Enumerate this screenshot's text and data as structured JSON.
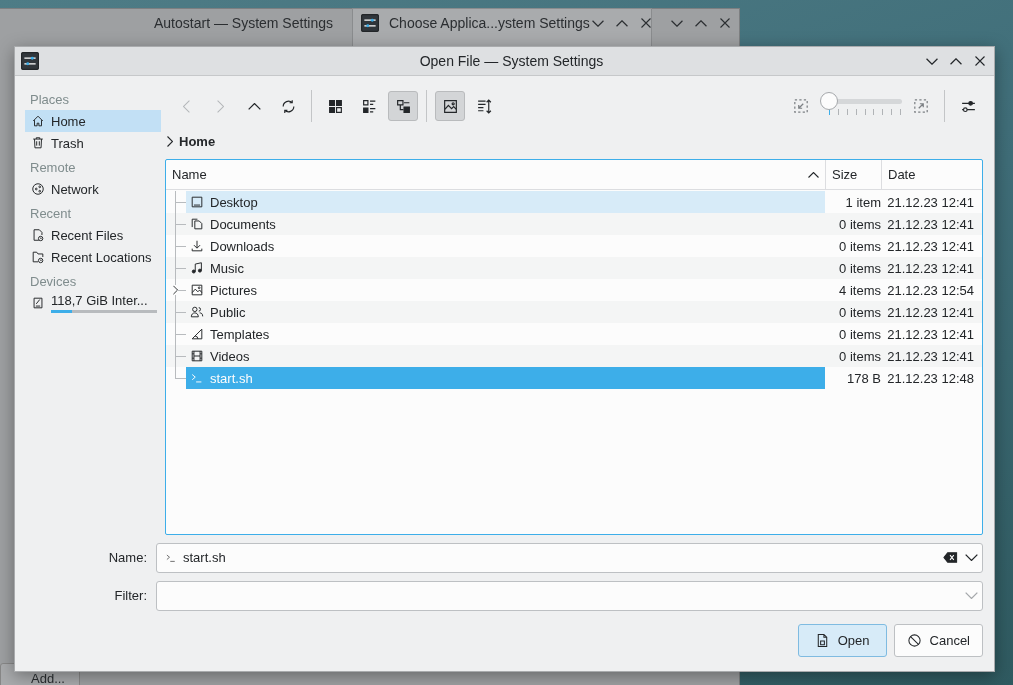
{
  "background_windows": [
    {
      "title": "Autostart — System Settings"
    },
    {
      "title": "Choose Applica...ystem Settings"
    }
  ],
  "background_button": {
    "label": "Add..."
  },
  "window": {
    "title": "Open File — System Settings"
  },
  "sidebar": {
    "sections": [
      {
        "heading": "Places",
        "items": [
          {
            "label": "Home",
            "selected": true
          },
          {
            "label": "Trash",
            "selected": false
          }
        ]
      },
      {
        "heading": "Remote",
        "items": [
          {
            "label": "Network",
            "selected": false
          }
        ]
      },
      {
        "heading": "Recent",
        "items": [
          {
            "label": "Recent Files",
            "selected": false
          },
          {
            "label": "Recent Locations",
            "selected": false
          }
        ]
      },
      {
        "heading": "Devices",
        "items": [
          {
            "label": "118,7 GiB Inter...",
            "selected": false,
            "level": 0.2
          }
        ]
      }
    ]
  },
  "toolbar": {
    "groups": [
      [
        {
          "disabled": true,
          "on": false
        },
        {
          "disabled": true,
          "on": false
        },
        {
          "disabled": false,
          "on": false
        },
        {
          "disabled": false,
          "on": false
        }
      ],
      [
        {
          "disabled": false,
          "on": false
        },
        {
          "disabled": false,
          "on": false
        },
        {
          "disabled": false,
          "on": true
        }
      ],
      [
        {
          "disabled": false,
          "on": true
        },
        {
          "disabled": false,
          "on": false
        }
      ]
    ],
    "zoom": {
      "level": 0
    }
  },
  "breadcrumb": {
    "label": "Home"
  },
  "table": {
    "columns": [
      {
        "label": "Name",
        "sorted": true
      },
      {
        "label": "Size",
        "sorted": false
      },
      {
        "label": "Date",
        "sorted": false
      }
    ],
    "rows": [
      {
        "name": "Desktop",
        "size": "1 item",
        "date": "21.12.23 12:41",
        "selected": false,
        "hovered": true,
        "expandable": false
      },
      {
        "name": "Documents",
        "size": "0 items",
        "date": "21.12.23 12:41",
        "selected": false,
        "hovered": false,
        "expandable": false
      },
      {
        "name": "Downloads",
        "size": "0 items",
        "date": "21.12.23 12:41",
        "selected": false,
        "hovered": false,
        "expandable": false
      },
      {
        "name": "Music",
        "size": "0 items",
        "date": "21.12.23 12:41",
        "selected": false,
        "hovered": false,
        "expandable": false
      },
      {
        "name": "Pictures",
        "size": "4 items",
        "date": "21.12.23 12:54",
        "selected": false,
        "hovered": false,
        "expandable": true
      },
      {
        "name": "Public",
        "size": "0 items",
        "date": "21.12.23 12:41",
        "selected": false,
        "hovered": false,
        "expandable": false
      },
      {
        "name": "Templates",
        "size": "0 items",
        "date": "21.12.23 12:41",
        "selected": false,
        "hovered": false,
        "expandable": false
      },
      {
        "name": "Videos",
        "size": "0 items",
        "date": "21.12.23 12:41",
        "selected": false,
        "hovered": false,
        "expandable": false
      },
      {
        "name": "start.sh",
        "size": "178 B",
        "date": "21.12.23 12:48",
        "selected": true,
        "hovered": false,
        "expandable": false
      }
    ]
  },
  "name_field": {
    "label": "Name:",
    "value": "start.sh"
  },
  "filter_field": {
    "label": "Filter:"
  },
  "buttons": [
    {
      "label": "Open",
      "kind": "open",
      "default": true
    },
    {
      "label": "Cancel",
      "kind": "cancel",
      "default": false
    }
  ]
}
